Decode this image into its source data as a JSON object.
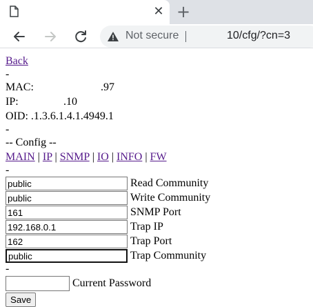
{
  "browser": {
    "tab": {
      "title": "",
      "close_icon": "close-icon",
      "favicon": "page-icon"
    },
    "new_tab_icon": "plus-icon",
    "toolbar": {
      "back_icon": "arrow-left-icon",
      "forward_icon": "arrow-right-icon",
      "reload_icon": "reload-icon"
    },
    "address_bar": {
      "security_label": "Not secure",
      "url": "10/cfg/?cn=3"
    }
  },
  "page": {
    "back_link": "Back",
    "separator": "-",
    "mac_label": "MAC:",
    "mac_value": ".97",
    "ip_label": "IP:",
    "ip_value": ".10",
    "oid_line": "OID: .1.3.6.1.4.1.4949.1",
    "config_heading": "-- Config --",
    "nav_links": [
      {
        "label": "MAIN"
      },
      {
        "label": "IP"
      },
      {
        "label": "SNMP"
      },
      {
        "label": "IO"
      },
      {
        "label": "INFO"
      },
      {
        "label": "FW"
      }
    ],
    "nav_separator": " | ",
    "fields": [
      {
        "value": "public",
        "label": "Read Community"
      },
      {
        "value": "public",
        "label": "Write Community"
      },
      {
        "value": "161",
        "label": "SNMP Port"
      },
      {
        "value": "192.168.0.1",
        "label": "Trap IP"
      },
      {
        "value": "162",
        "label": "Trap Port"
      },
      {
        "value": "public",
        "label": "Trap Community"
      }
    ],
    "password_label": "Current Password",
    "password_value": "",
    "save_label": "Save"
  }
}
